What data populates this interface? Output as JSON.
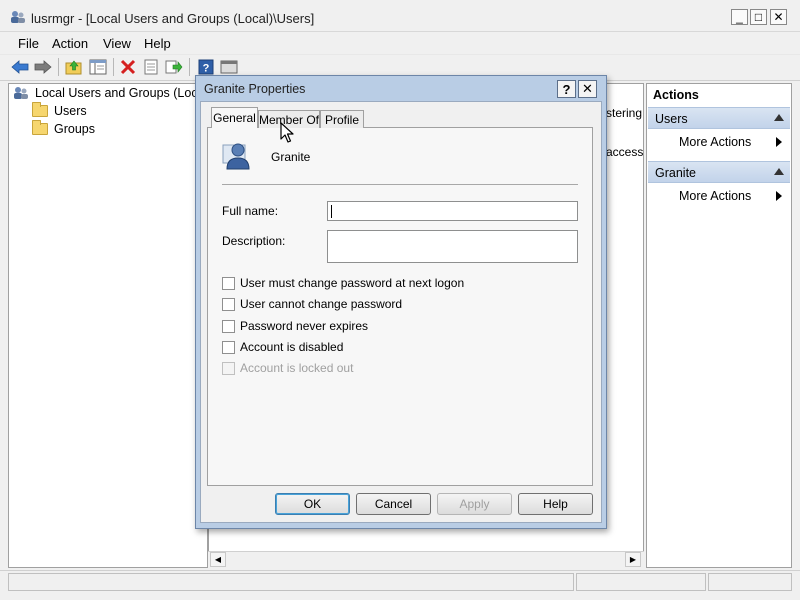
{
  "window": {
    "title": "lusrmgr - [Local Users and Groups (Local)\\Users]",
    "minimize": "_",
    "maximize": "□",
    "close": "✕"
  },
  "menu": [
    "File",
    "Action",
    "View",
    "Help"
  ],
  "toolbar_icons": [
    "back-icon",
    "forward-icon",
    "up-folder-icon",
    "show-hide-tree-icon",
    "delete-icon",
    "properties-icon",
    "export-icon",
    "help-icon",
    "console-icon"
  ],
  "tree": {
    "root": "Local Users and Groups (Local",
    "items": [
      "Users",
      "Groups"
    ]
  },
  "middle": {
    "fragments": [
      "stering",
      "access"
    ]
  },
  "actions": {
    "title": "Actions",
    "sections": [
      {
        "title": "Users",
        "item": "More Actions"
      },
      {
        "title": "Granite",
        "item": "More Actions"
      }
    ]
  },
  "dialog": {
    "title": "Granite Properties",
    "help": "?",
    "close": "✕",
    "tabs": [
      "General",
      "Member Of",
      "Profile"
    ],
    "active_tab": "General",
    "user_name": "Granite",
    "full_name_label": "Full name:",
    "full_name_value": "",
    "description_label": "Description:",
    "description_value": "",
    "checkboxes": [
      {
        "label": "User must change password at next logon",
        "checked": false,
        "enabled": true
      },
      {
        "label": "User cannot change password",
        "checked": false,
        "enabled": true
      },
      {
        "label": "Password never expires",
        "checked": false,
        "enabled": true
      },
      {
        "label": "Account is disabled",
        "checked": false,
        "enabled": true
      },
      {
        "label": "Account is locked out",
        "checked": false,
        "enabled": false
      }
    ],
    "buttons": {
      "ok": "OK",
      "cancel": "Cancel",
      "apply": "Apply",
      "help": "Help"
    }
  },
  "colors": {
    "dialog_frame": "#b9cde5",
    "actions_header": "#c2d3ea",
    "delete_red": "#d52020"
  }
}
